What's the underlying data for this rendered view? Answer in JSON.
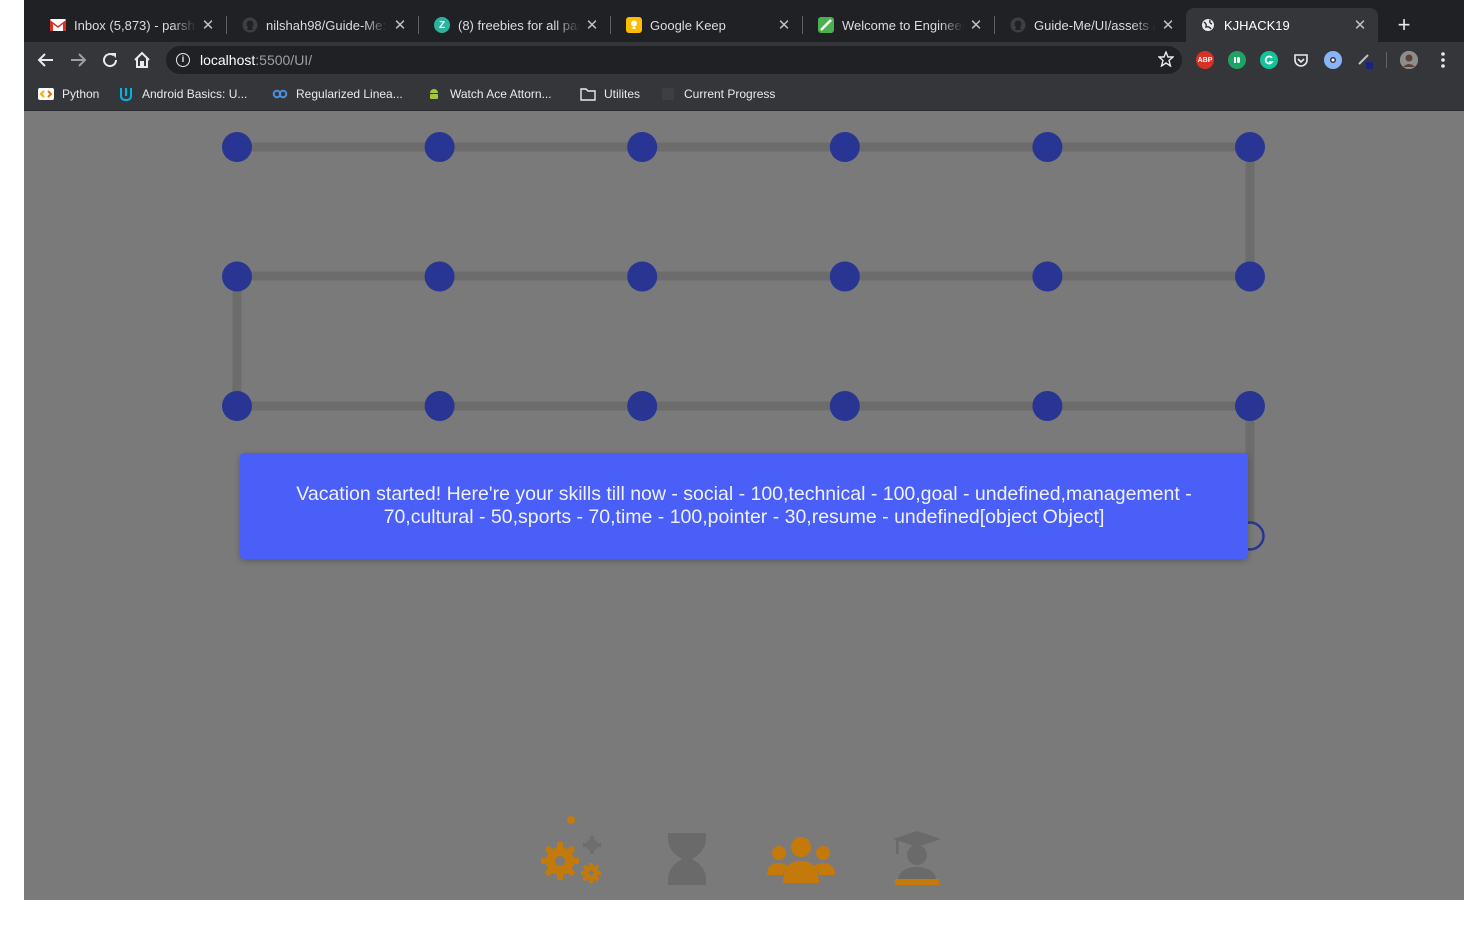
{
  "tabs": [
    {
      "title": "Inbox (5,873) - parshv",
      "icon": "gmail-icon",
      "active": false
    },
    {
      "title": "nilshah98/Guide-Me: ",
      "icon": "github-icon",
      "active": false
    },
    {
      "title": "(8) freebies for all part",
      "icon": "z-icon",
      "active": false
    },
    {
      "title": "Google Keep",
      "icon": "keep-icon",
      "active": false
    },
    {
      "title": "Welcome to Engineerin",
      "icon": "engineering-icon",
      "active": false
    },
    {
      "title": "Guide-Me/UI/assets at",
      "icon": "github-icon",
      "active": false
    },
    {
      "title": "KJHACK19",
      "icon": "globe-icon",
      "active": true
    }
  ],
  "new_tab_label": "+",
  "address": {
    "host": "localhost",
    "path": ":5500/UI/"
  },
  "extensions": [
    "adblock-icon",
    "green-extension-icon",
    "grammarly-icon",
    "pocket-icon",
    "extension-icon",
    "pen-icon",
    "profile-avatar"
  ],
  "bookmarks": [
    {
      "label": "Python",
      "icon": "colab-icon"
    },
    {
      "label": "Android Basics: U...",
      "icon": "udacity-icon"
    },
    {
      "label": "Regularized Linea...",
      "icon": "coursera-icon"
    },
    {
      "label": "Watch Ace Attorn...",
      "icon": "android-icon"
    },
    {
      "label": "Utilites",
      "icon": "folder-icon"
    },
    {
      "label": "Current Progress",
      "icon": "page-icon"
    }
  ],
  "board": {
    "rows": 3,
    "cols": 6,
    "node_color": "#283593",
    "path_color": "#6c6c6c",
    "current_node": "empty circle below last row"
  },
  "toast": {
    "message": "Vacation started! Here're your skills till now - social - 100,technical - 100,goal - undefined,management - 70,cultural - 50,sports - 70,time - 100,pointer - 30,resume - undefined[object Object]",
    "color": "#4a5ef8"
  },
  "skill_bar": [
    {
      "name": "technical-gears-icon",
      "color": "#c47a0a"
    },
    {
      "name": "hourglass-icon",
      "color": "#6a6a6a"
    },
    {
      "name": "group-icon",
      "color": "#c47a0a"
    },
    {
      "name": "graduate-icon",
      "color": "#6a6a6a"
    }
  ]
}
